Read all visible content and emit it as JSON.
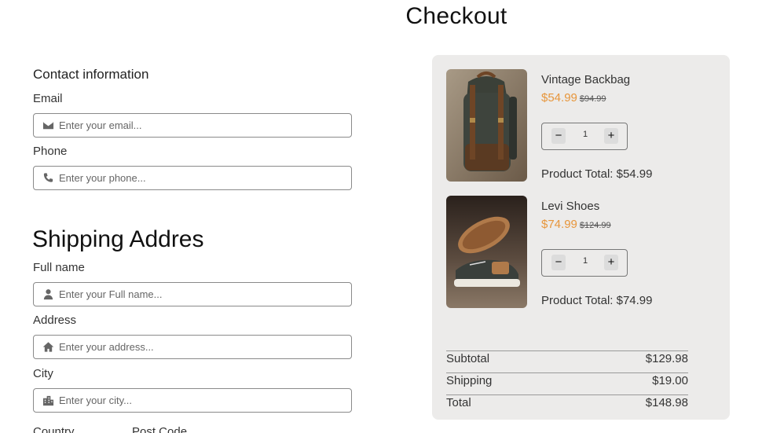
{
  "page": {
    "title": "Checkout"
  },
  "contact": {
    "heading": "Contact information",
    "email_label": "Email",
    "email_placeholder": "Enter your email...",
    "phone_label": "Phone",
    "phone_placeholder": "Enter your phone..."
  },
  "shipping": {
    "heading": "Shipping Addres",
    "fullname_label": "Full name",
    "fullname_placeholder": "Enter your Full name...",
    "address_label": "Address",
    "address_placeholder": "Enter your address...",
    "city_label": "City",
    "city_placeholder": "Enter your city...",
    "country_label": "Country",
    "postcode_label": "Post Code"
  },
  "cart": {
    "items": [
      {
        "name": "Vintage Backbag",
        "price": "$54.99",
        "old_price": "$94.99",
        "quantity": "1",
        "minus": "−",
        "plus": "+",
        "total": "Product Total: $54.99",
        "image_icon": "backpack-image"
      },
      {
        "name": "Levi Shoes",
        "price": "$74.99",
        "old_price": "$124.99",
        "quantity": "1",
        "minus": "−",
        "plus": "+",
        "total": "Product Total: $74.99",
        "image_icon": "shoes-image"
      }
    ],
    "totals": {
      "subtotal_label": "Subtotal",
      "subtotal_value": "$129.98",
      "shipping_label": "Shipping",
      "shipping_value": "$19.00",
      "total_label": "Total",
      "total_value": "$148.98"
    }
  },
  "colors": {
    "accent_price": "#e7963c",
    "summary_bg": "#ecebea"
  },
  "icons": {
    "email": "envelope-icon",
    "phone": "phone-icon",
    "fullname": "user-icon",
    "address": "home-icon",
    "city": "city-icon"
  }
}
